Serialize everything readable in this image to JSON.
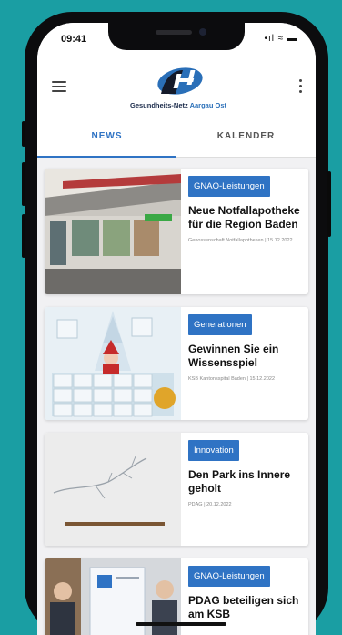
{
  "status": {
    "time": "09:41",
    "indicators": "•ıl ≈ ▬"
  },
  "appbar": {
    "logo_text_main": "Gesundheits-Netz",
    "logo_text_accent": "Aargau Ost"
  },
  "tabs": [
    {
      "label": "NEWS",
      "active": true
    },
    {
      "label": "KALENDER",
      "active": false
    }
  ],
  "articles": [
    {
      "category": "GNAO-Leistungen",
      "title": "Neue Notfallapotheke für die Region Baden",
      "meta": "Genossenschaft Notfallapotheken | 15.12.2022"
    },
    {
      "category": "Generationen",
      "title": "Gewinnen Sie ein Wissensspiel",
      "meta": "KSB Kantonsspital Baden | 15.12.2022"
    },
    {
      "category": "Innovation",
      "title": "Den Park ins Innere geholt",
      "meta": "PDAG | 20.12.2022"
    },
    {
      "category": "GNAO-Leistungen",
      "title": "PDAG beteiligen sich am KSB",
      "meta": ""
    }
  ],
  "colors": {
    "accent": "#2f73c4",
    "background": "#1a9ea3"
  }
}
